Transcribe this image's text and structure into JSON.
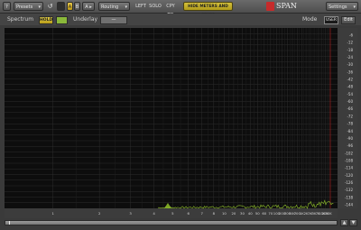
{
  "toolbar": {
    "help": "?",
    "presets": "Presets",
    "presets_arrow": "▾",
    "undo": "↺",
    "copy_square": "■",
    "a": "A",
    "b": "B",
    "ab_copy": "A ▸ B",
    "routing": "Routing",
    "routing_arrow": "▾",
    "left": "LEFT",
    "solo": "SOLO",
    "copy_to": "CPY TO",
    "hide_meters": "HIDE METERS AND STATS",
    "logo_text": "SPAN",
    "settings": "Settings",
    "settings_arrow": "▾"
  },
  "subbar": {
    "spectrum_label": "Spectrum",
    "hold": "HOLD",
    "underlay_label": "Underlay",
    "underlay_value": "—",
    "mode_label": "Mode",
    "mode_value": "USER",
    "edit": "Edit"
  },
  "db_scale": [
    "-6",
    "-12",
    "-18",
    "-24",
    "-30",
    "-36",
    "-42",
    "-48",
    "-54",
    "-60",
    "-66",
    "-72",
    "-78",
    "-84",
    "-90",
    "-96",
    "-102",
    "-108",
    "-114",
    "-120",
    "-126",
    "-132",
    "-138",
    "-144"
  ],
  "freq_labels": [
    "1",
    "2",
    "3",
    "4",
    "5",
    "6",
    "7",
    "8",
    "10",
    "20",
    "30",
    "40",
    "50",
    "60",
    "70",
    "100",
    "200",
    "300",
    "500",
    "700",
    "1K",
    "2K",
    "3K",
    "5K",
    "7K",
    "10K",
    "20K",
    "30K"
  ],
  "colors": {
    "graph_bg": "#0d0d0d",
    "grid": "#2c2c2c",
    "spectrum": "#8fbf2a",
    "hold_button": "#d0b83a",
    "limit_line": "#a02020"
  }
}
